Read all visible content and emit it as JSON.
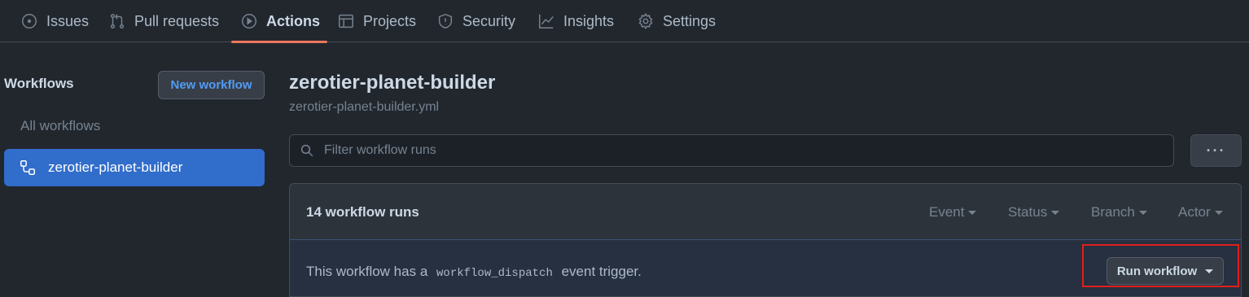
{
  "nav": {
    "tabs": [
      {
        "label": "Issues",
        "icon": "issue-circle-icon"
      },
      {
        "label": "Pull requests",
        "icon": "pull-request-icon"
      },
      {
        "label": "Actions",
        "icon": "play-icon",
        "active": true
      },
      {
        "label": "Projects",
        "icon": "table-icon"
      },
      {
        "label": "Security",
        "icon": "shield-icon"
      },
      {
        "label": "Insights",
        "icon": "graph-icon"
      },
      {
        "label": "Settings",
        "icon": "gear-icon"
      }
    ],
    "active_underline_color": "#ec775c"
  },
  "sidebar": {
    "title": "Workflows",
    "new_workflow_label": "New workflow",
    "all_workflows_label": "All workflows",
    "items": [
      {
        "label": "zerotier-planet-builder",
        "icon": "workflow-icon",
        "selected": true
      }
    ]
  },
  "main": {
    "title": "zerotier-planet-builder",
    "subtitle": "zerotier-planet-builder.yml",
    "filter_placeholder": "Filter workflow runs",
    "more_label": "···",
    "runs_count": "14 workflow runs",
    "filters": [
      "Event",
      "Status",
      "Branch",
      "Actor"
    ],
    "dispatch": {
      "prefix": "This workflow has a",
      "code": "workflow_dispatch",
      "suffix": "event trigger."
    },
    "run_workflow_label": "Run workflow"
  },
  "colors": {
    "background": "#22272e",
    "accent_blue": "#316dca",
    "link_blue": "#539bf5",
    "highlight_red": "#e0201b"
  }
}
